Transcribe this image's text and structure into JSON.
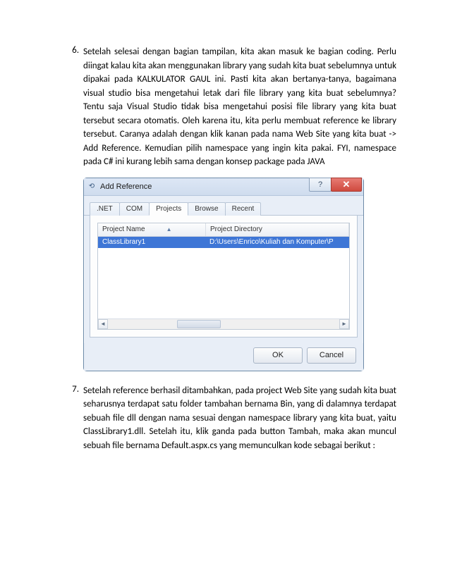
{
  "items": {
    "6": {
      "num": "6.",
      "text": "Setelah selesai dengan bagian tampilan, kita akan masuk ke bagian coding. Perlu diingat kalau kita akan menggunakan library yang sudah kita buat sebelumnya untuk dipakai pada KALKULATOR GAUL ini. Pasti kita akan bertanya-tanya, bagaimana visual studio bisa mengetahui letak dari file library yang kita buat sebelumnya? Tentu saja Visual Studio tidak bisa mengetahui posisi file library yang kita buat tersebut secara otomatis. Oleh karena itu, kita perlu membuat reference ke library tersebut. Caranya adalah dengan klik kanan pada nama Web Site yang kita buat -> Add Reference. Kemudian pilih namespace yang ingin kita pakai. FYI, namespace pada C# ini kurang lebih sama dengan konsep package pada JAVA"
    },
    "7": {
      "num": "7.",
      "text": "Setelah reference berhasil ditambahkan, pada project Web Site yang sudah kita buat seharusnya terdapat satu folder tambahan bernama Bin, yang di dalamnya terdapat sebuah file dll dengan nama sesuai dengan namespace library yang kita buat, yaitu ClassLibrary1.dll. Setelah itu, klik ganda pada button Tambah, maka akan muncul sebuah file bernama Default.aspx.cs yang memunculkan kode sebagai berikut :"
    }
  },
  "dialog": {
    "title": "Add Reference",
    "tabs": {
      "net": ".NET",
      "com": "COM",
      "projects": "Projects",
      "browse": "Browse",
      "recent": "Recent"
    },
    "columns": {
      "name": "Project Name",
      "dir": "Project Directory"
    },
    "row": {
      "name": "ClassLibrary1",
      "dir": "D:\\Users\\Enrico\\Kuliah dan Komputer\\P"
    },
    "buttons": {
      "ok": "OK",
      "cancel": "Cancel"
    }
  }
}
